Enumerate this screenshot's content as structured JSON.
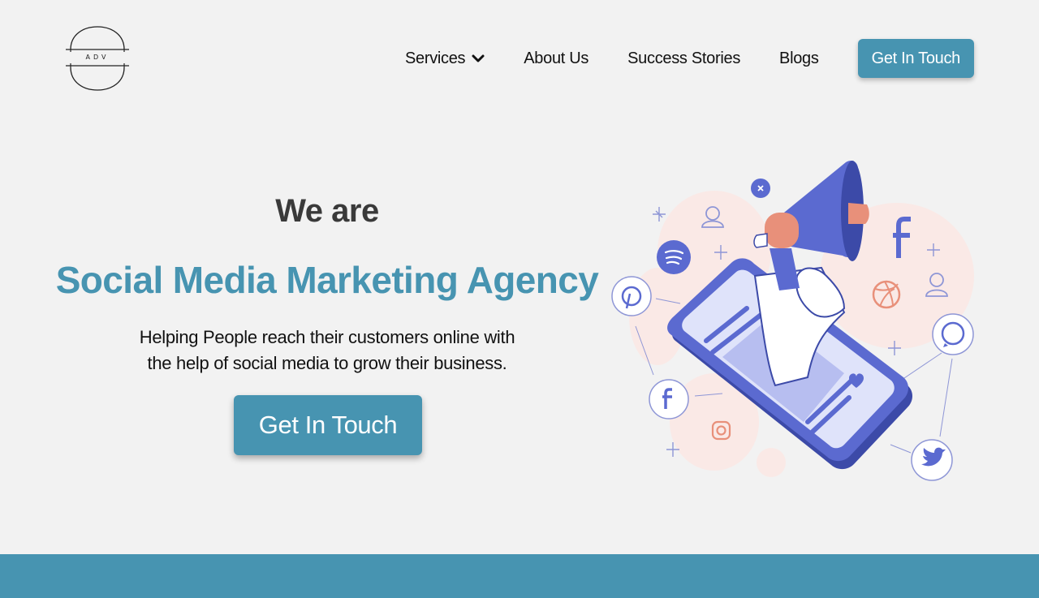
{
  "logo": {
    "text": "ADV"
  },
  "nav": {
    "items": [
      {
        "label": "Services",
        "has_dropdown": true
      },
      {
        "label": "About Us"
      },
      {
        "label": "Success Stories"
      },
      {
        "label": "Blogs"
      }
    ],
    "cta_label": "Get In Touch"
  },
  "hero": {
    "kicker": "We are",
    "headline": "Social Media Marketing Agency",
    "subtext_line1": "Helping People reach their customers online with",
    "subtext_line2": "the help of social media to grow their business.",
    "cta_label": "Get In Touch"
  },
  "illustration": {
    "icons": [
      "megaphone-icon",
      "phone-icon",
      "facebook-icon",
      "pinterest-icon",
      "spotify-icon",
      "dribbble-icon",
      "whatsapp-icon",
      "twitter-icon",
      "instagram-icon",
      "user-icon",
      "close-icon",
      "heart-icon",
      "sparkle-icon"
    ]
  },
  "colors": {
    "accent": "#4794b1",
    "background": "#f2f2f2",
    "illustration_primary": "#5b6ad0",
    "illustration_secondary": "#e8907a"
  }
}
